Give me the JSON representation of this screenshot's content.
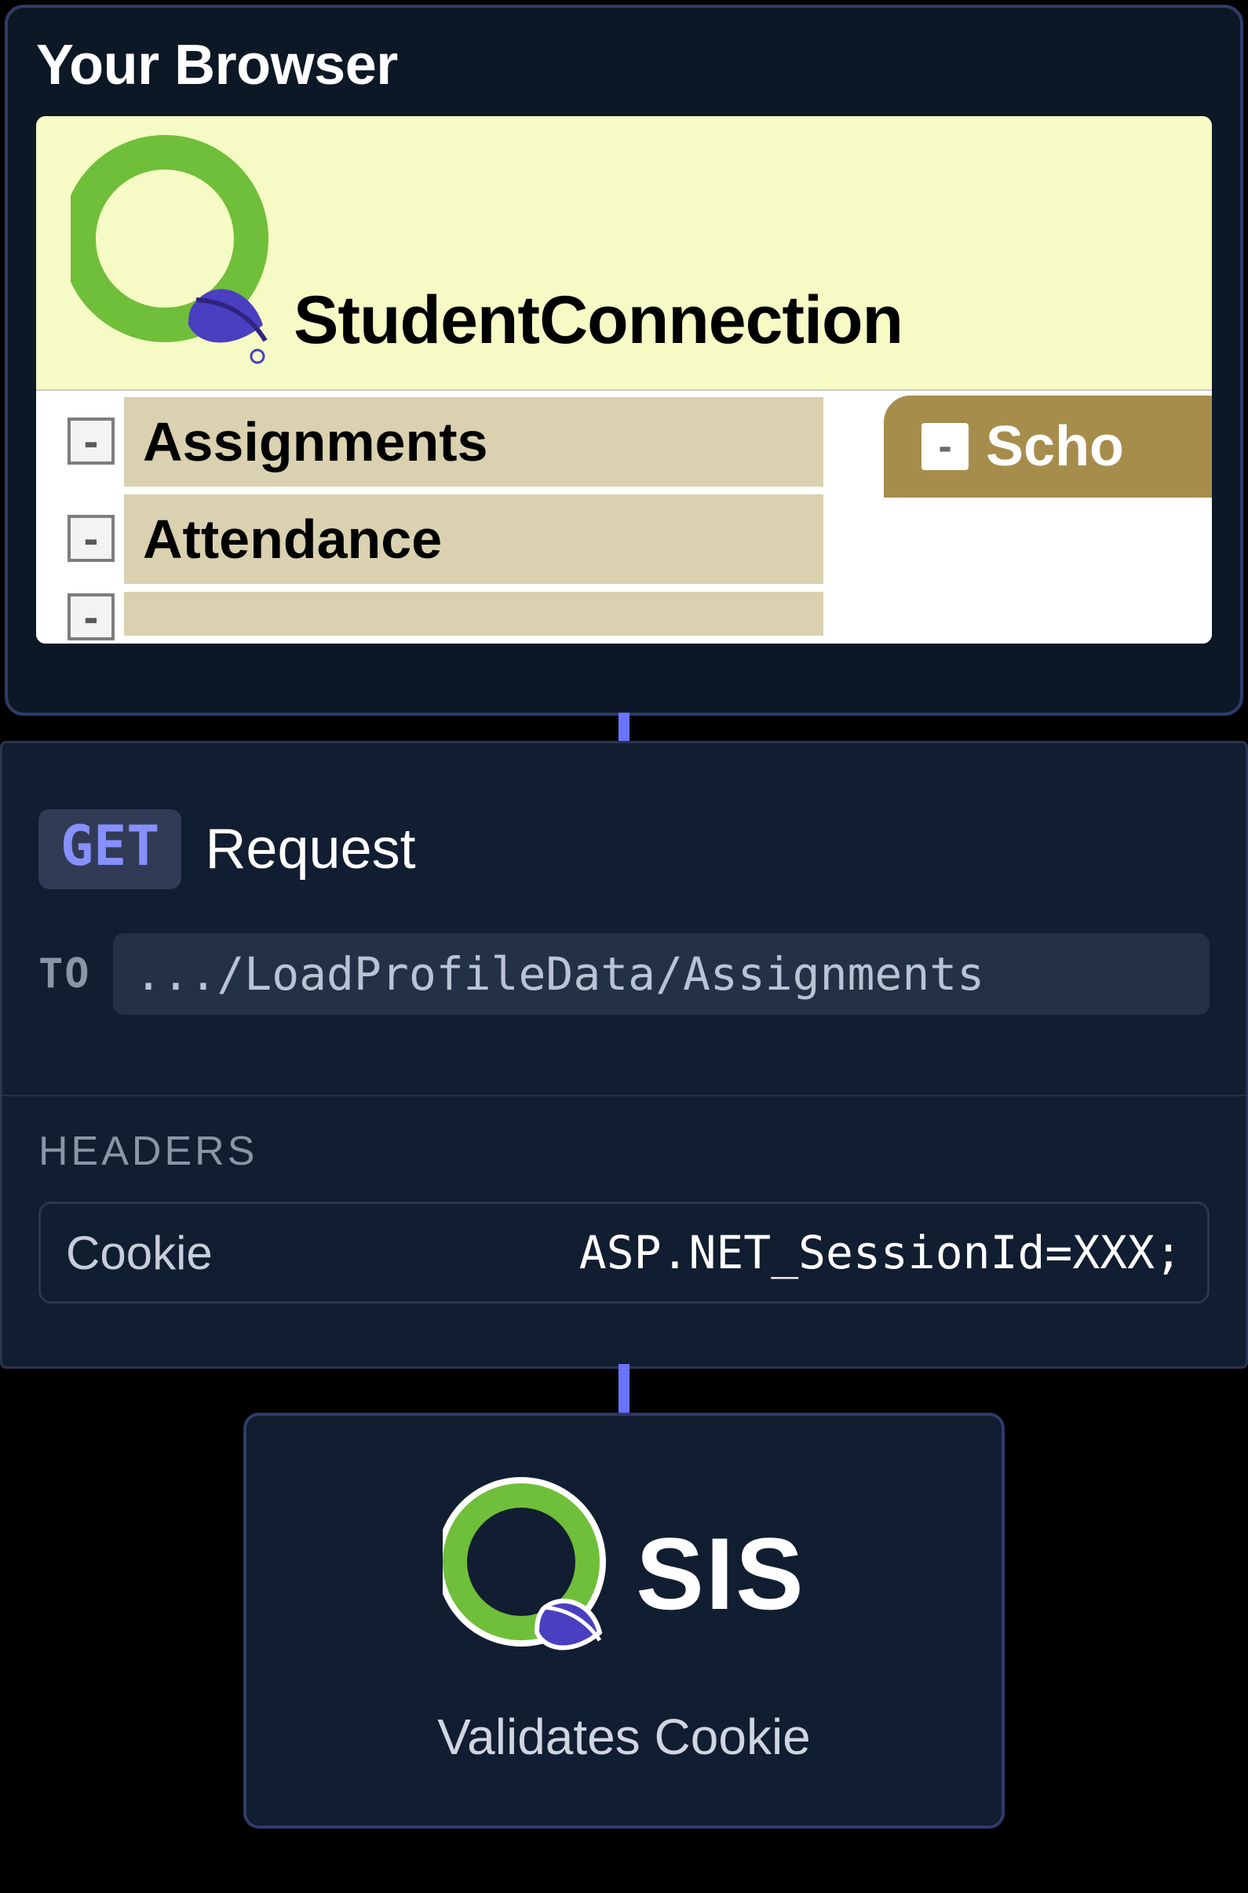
{
  "browser": {
    "title": "Your Browser",
    "app_name": "StudentConnection",
    "nav_items": [
      "Assignments",
      "Attendance"
    ],
    "right_tab_label": "Scho"
  },
  "request": {
    "method": "GET",
    "word": "Request",
    "to_label": "TO",
    "url": ".../LoadProfileData/Assignments",
    "headers_label": "HEADERS",
    "header_key": "Cookie",
    "header_value": "ASP.NET_SessionId=XXX;"
  },
  "sis": {
    "label": "SIS",
    "subtitle": "Validates Cookie"
  }
}
